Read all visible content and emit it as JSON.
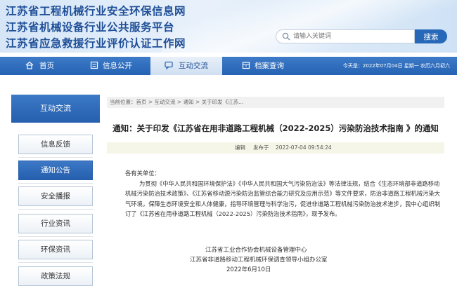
{
  "banner": {
    "line1": "江苏省工程机械行业安全环保信息网",
    "line2": "江苏省机械设备行业公共服务平台",
    "line3": "江苏省应急救援行业评价认证工作网"
  },
  "search": {
    "placeholder": "请输入关键词",
    "button": "搜索"
  },
  "nav": {
    "items": [
      {
        "label": "首页",
        "icon": "home-icon"
      },
      {
        "label": "信息公开",
        "icon": "info-icon"
      },
      {
        "label": "互动交流",
        "icon": "chat-icon"
      },
      {
        "label": "档案查询",
        "icon": "archive-icon"
      }
    ],
    "active_index": 2,
    "date_text": "今天是：2022年07月04日 星期一 农历六月初六"
  },
  "sidebar": {
    "title": "互动交流",
    "items": [
      {
        "label": "信息反馈"
      },
      {
        "label": "通知公告"
      },
      {
        "label": "安全播报"
      },
      {
        "label": "行业资讯"
      },
      {
        "label": "环保资讯"
      },
      {
        "label": "政策法规"
      }
    ],
    "active_index": 1
  },
  "breadcrumb": "当前位置：首页 > 互动交流 > 通知 > 关于印发《江苏...",
  "article": {
    "title": "通知：关于印发《江苏省在用非道路工程机械（2022-2025）污染防治技术指南 》的通知",
    "meta_editor": "编辑",
    "meta_publish": "发布于",
    "meta_date": "2022-07-04 09:54:24",
    "greeting": "各有关单位：",
    "paragraph": "为贯彻《中华人民共和国环境保护法》《中华人民共和国大气污染防治法》等法律法规，结合《生态环境部非道路移动机械污染防治技术政策》、《江苏省移动源污染防治监管综合能力研究及应用示范》等文件要求，防治非道路工程机械污染大气环境，保障生态环境安全和人体健康，指导环境管理与科学治污，促进非道路工程机械污染防治技术进步，我中心组织制订了《江苏省在用非道路工程机械（2022-2025）污染防治技术指南》，现予发布。",
    "signature1": "江苏省工业合作协会机械设备管理中心",
    "signature2": "江苏省非道路移动工程机械环保调查领导小组办公室",
    "signature_date": "2022年6月10日"
  }
}
